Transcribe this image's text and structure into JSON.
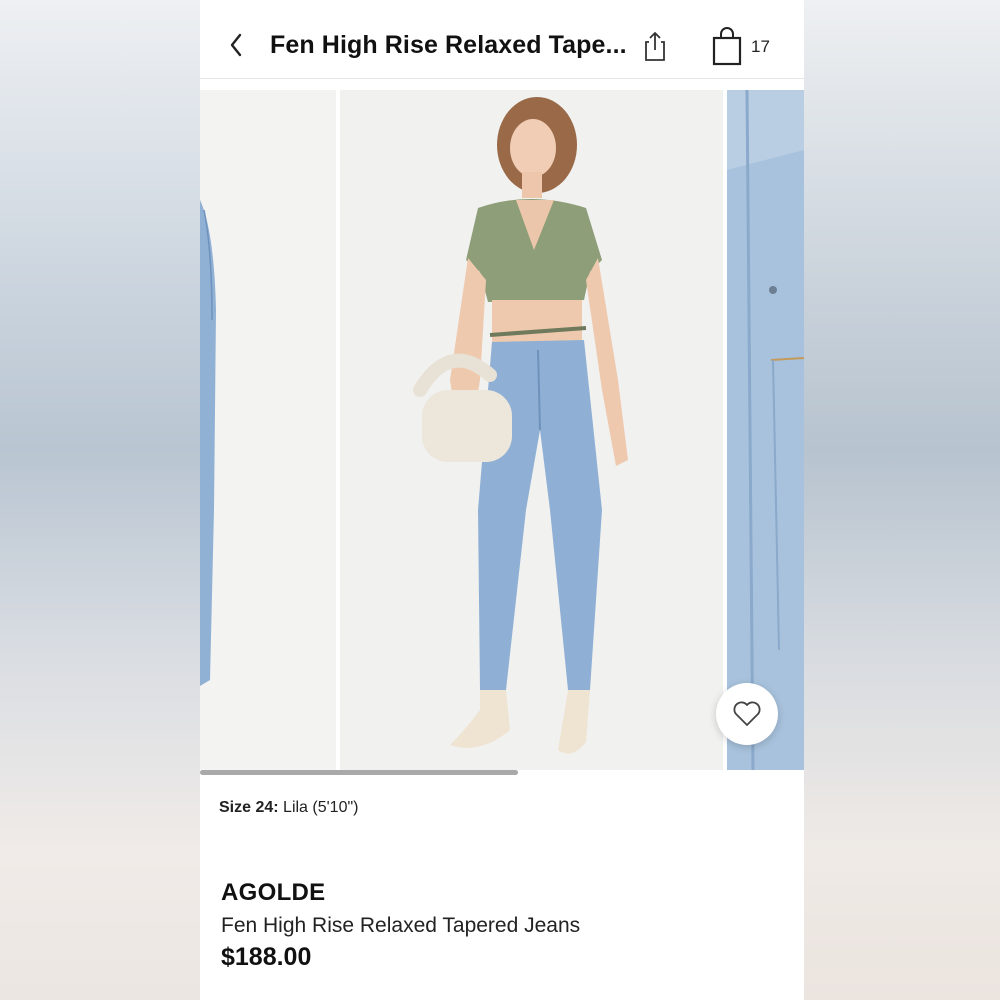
{
  "header": {
    "title": "Fen High Rise Relaxed Tape...",
    "bag_count": "17"
  },
  "gallery": {
    "slides": [
      "product-photo-jeans-side",
      "product-photo-model-full",
      "product-photo-denim-detail"
    ],
    "active_index": 1
  },
  "model_info": {
    "size_label": "Size 24:",
    "model_text": "Lila (5'10\")"
  },
  "product": {
    "brand": "AGOLDE",
    "name": "Fen High Rise Relaxed Tapered Jeans",
    "price": "$188.00"
  },
  "icons": {
    "back": "chevron-left-icon",
    "share": "share-icon",
    "bag": "shopping-bag-icon",
    "favorite": "heart-icon"
  },
  "colors": {
    "denim": "#8fb0d4",
    "top": "#8e9e78",
    "text": "#111111"
  }
}
